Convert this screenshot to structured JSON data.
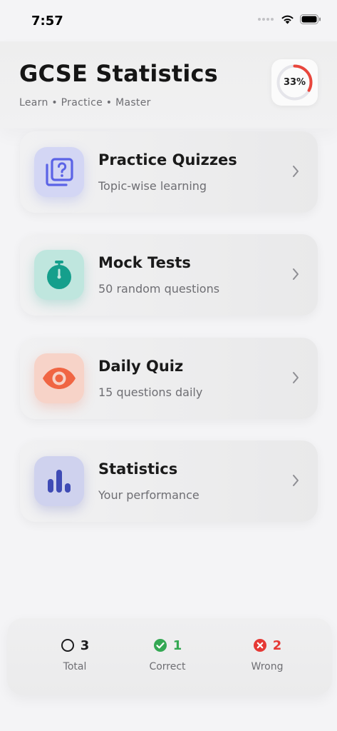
{
  "status_bar": {
    "time": "7:57"
  },
  "header": {
    "title": "GCSE Statistics",
    "subtitle": "Learn • Practice • Master",
    "progress": {
      "label": "33%",
      "value": 0.33,
      "track_color": "#e5e5ea",
      "fill_color": "#e8463c"
    }
  },
  "menu": [
    {
      "title": "Practice Quizzes",
      "subtitle": "Topic-wise learning",
      "icon": "quiz-cards-icon",
      "color": "#5b63e6"
    },
    {
      "title": "Mock Tests",
      "subtitle": "50 random questions",
      "icon": "stopwatch-icon",
      "color": "#159f8c"
    },
    {
      "title": "Daily Quiz",
      "subtitle": "15 questions daily",
      "icon": "eye-icon",
      "color": "#f06543"
    },
    {
      "title": "Statistics",
      "subtitle": "Your performance",
      "icon": "bar-chart-icon",
      "color": "#3f4bb5"
    }
  ],
  "summary": {
    "total": {
      "value": "3",
      "label": "Total",
      "color": "#1c1c1e"
    },
    "correct": {
      "value": "1",
      "label": "Correct",
      "color": "#34a853"
    },
    "wrong": {
      "value": "2",
      "label": "Wrong",
      "color": "#e53935"
    }
  }
}
